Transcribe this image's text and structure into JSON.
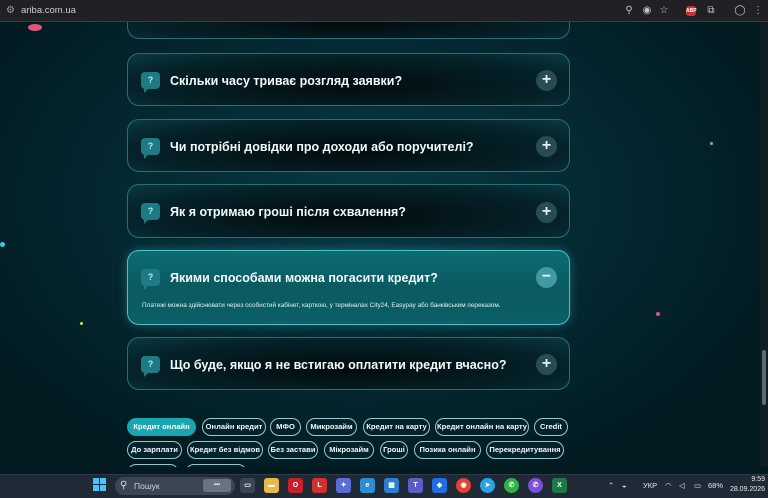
{
  "browser": {
    "url": "ariba.com.ua",
    "icons": [
      "site-info-icon",
      "zoom-icon",
      "eye-off-icon",
      "star-icon",
      "adblock-icon",
      "extensions-icon",
      "profile-icon",
      "menu-icon"
    ],
    "adblock_label": "ABP"
  },
  "faq": {
    "items": [
      {
        "question": "Скільки часу триває розгляд заявки?",
        "expanded": false,
        "toggle": "+"
      },
      {
        "question": "Чи потрібні довідки про доходи або поручителі?",
        "expanded": false,
        "toggle": "+"
      },
      {
        "question": "Як я отримаю гроші після схвалення?",
        "expanded": false,
        "toggle": "+"
      },
      {
        "question": "Якими способами можна погасити кредит?",
        "expanded": true,
        "toggle": "−",
        "answer": "Платежі можна здійснювати через особистий кабінет, карткою, у терміналах City24, Easypay або банківським переказом."
      },
      {
        "question": "Що буде, якщо я не встигаю оплатити кредит вчасно?",
        "expanded": false,
        "toggle": "+"
      }
    ],
    "question_icon": "?"
  },
  "tags": {
    "row1": [
      "Кредит онлайн",
      "Онлайн кредит",
      "МФО",
      "Микрозайм",
      "Кредит на карту",
      "Кредит онлайн на карту",
      "Credit"
    ],
    "row2": [
      "До зарплати",
      "Кредит без відмов",
      "Без застави",
      "Мікрозайм",
      "Гроші",
      "Позика онлайн",
      "Перекредитування"
    ],
    "active": "Кредит онлайн"
  },
  "taskbar": {
    "search_placeholder": "Пошук",
    "language": "УКР",
    "battery": "68%",
    "time": "9:59",
    "date": "28.09.2026"
  },
  "colors": {
    "accent": "#18a6b1",
    "card_border": "#2d6c74",
    "expanded_card": "#0b5f66",
    "page_bg": "#031b22"
  }
}
